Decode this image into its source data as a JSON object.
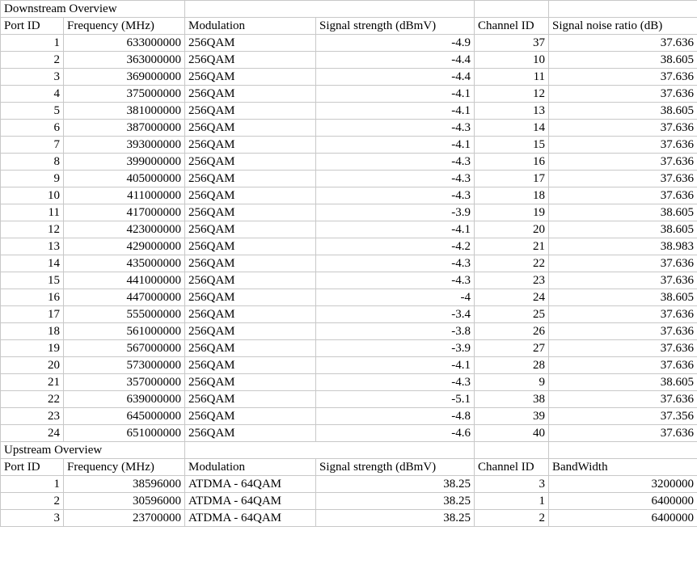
{
  "downstream": {
    "section_title": "Downstream Overview",
    "columns": [
      "Port ID",
      "Frequency (MHz)",
      "Modulation",
      "Signal strength (dBmV)",
      "Channel ID",
      "Signal noise ratio (dB)"
    ],
    "rows": [
      [
        "1",
        "633000000",
        "256QAM",
        "-4.9",
        "37",
        "37.636"
      ],
      [
        "2",
        "363000000",
        "256QAM",
        "-4.4",
        "10",
        "38.605"
      ],
      [
        "3",
        "369000000",
        "256QAM",
        "-4.4",
        "11",
        "37.636"
      ],
      [
        "4",
        "375000000",
        "256QAM",
        "-4.1",
        "12",
        "37.636"
      ],
      [
        "5",
        "381000000",
        "256QAM",
        "-4.1",
        "13",
        "38.605"
      ],
      [
        "6",
        "387000000",
        "256QAM",
        "-4.3",
        "14",
        "37.636"
      ],
      [
        "7",
        "393000000",
        "256QAM",
        "-4.1",
        "15",
        "37.636"
      ],
      [
        "8",
        "399000000",
        "256QAM",
        "-4.3",
        "16",
        "37.636"
      ],
      [
        "9",
        "405000000",
        "256QAM",
        "-4.3",
        "17",
        "37.636"
      ],
      [
        "10",
        "411000000",
        "256QAM",
        "-4.3",
        "18",
        "37.636"
      ],
      [
        "11",
        "417000000",
        "256QAM",
        "-3.9",
        "19",
        "38.605"
      ],
      [
        "12",
        "423000000",
        "256QAM",
        "-4.1",
        "20",
        "38.605"
      ],
      [
        "13",
        "429000000",
        "256QAM",
        "-4.2",
        "21",
        "38.983"
      ],
      [
        "14",
        "435000000",
        "256QAM",
        "-4.3",
        "22",
        "37.636"
      ],
      [
        "15",
        "441000000",
        "256QAM",
        "-4.3",
        "23",
        "37.636"
      ],
      [
        "16",
        "447000000",
        "256QAM",
        "-4",
        "24",
        "38.605"
      ],
      [
        "17",
        "555000000",
        "256QAM",
        "-3.4",
        "25",
        "37.636"
      ],
      [
        "18",
        "561000000",
        "256QAM",
        "-3.8",
        "26",
        "37.636"
      ],
      [
        "19",
        "567000000",
        "256QAM",
        "-3.9",
        "27",
        "37.636"
      ],
      [
        "20",
        "573000000",
        "256QAM",
        "-4.1",
        "28",
        "37.636"
      ],
      [
        "21",
        "357000000",
        "256QAM",
        "-4.3",
        "9",
        "38.605"
      ],
      [
        "22",
        "639000000",
        "256QAM",
        "-5.1",
        "38",
        "37.636"
      ],
      [
        "23",
        "645000000",
        "256QAM",
        "-4.8",
        "39",
        "37.356"
      ],
      [
        "24",
        "651000000",
        "256QAM",
        "-4.6",
        "40",
        "37.636"
      ]
    ]
  },
  "upstream": {
    "section_title": "Upstream Overview",
    "columns": [
      "Port ID",
      "Frequency (MHz)",
      "Modulation",
      "Signal strength (dBmV)",
      "Channel ID",
      "BandWidth"
    ],
    "rows": [
      [
        "1",
        "38596000",
        "ATDMA - 64QAM",
        "38.25",
        "3",
        "3200000"
      ],
      [
        "2",
        "30596000",
        "ATDMA - 64QAM",
        "38.25",
        "1",
        "6400000"
      ],
      [
        "3",
        "23700000",
        "ATDMA - 64QAM",
        "38.25",
        "2",
        "6400000"
      ]
    ]
  },
  "style": {
    "grid_line_color": "#c8c8c8",
    "text_color": "#000000",
    "background_color": "#ffffff"
  }
}
